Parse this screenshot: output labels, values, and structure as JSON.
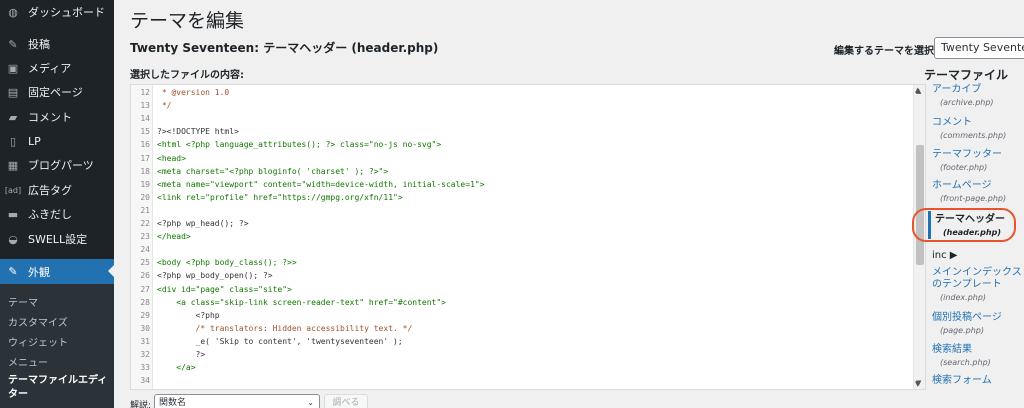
{
  "sidebar": {
    "items": [
      {
        "label": "ダッシュボード",
        "icon": "dashboard-icon",
        "glyph": "◍"
      },
      {
        "label": "投稿",
        "icon": "pin-icon",
        "glyph": "✎"
      },
      {
        "label": "メディア",
        "icon": "media-icon",
        "glyph": "▣"
      },
      {
        "label": "固定ページ",
        "icon": "page-icon",
        "glyph": "▤"
      },
      {
        "label": "コメント",
        "icon": "comment-icon",
        "glyph": "▰"
      },
      {
        "label": "LP",
        "icon": "document-icon",
        "glyph": "▯"
      },
      {
        "label": "ブログパーツ",
        "icon": "blog-parts-icon",
        "glyph": "▦"
      },
      {
        "label": "広告タグ",
        "icon": "ad-tag-icon",
        "glyph": "[ad]"
      },
      {
        "label": "ふきだし",
        "icon": "speech-bubble-icon",
        "glyph": "▬"
      },
      {
        "label": "SWELL設定",
        "icon": "swell-icon",
        "glyph": "◒"
      },
      {
        "label": "外観",
        "icon": "appearance-icon",
        "glyph": "✎"
      }
    ],
    "submenu": [
      {
        "label": "テーマ"
      },
      {
        "label": "カスタマイズ"
      },
      {
        "label": "ウィジェット"
      },
      {
        "label": "メニュー"
      },
      {
        "label": "テーマファイルエディ\nター"
      }
    ]
  },
  "header": {
    "title": "テーマを編集",
    "file_heading": "Twenty Seventeen: テーマヘッダー (header.php)",
    "select_label": "編集するテーマを選択:",
    "selected_theme": "Twenty Seventeen",
    "content_label": "選択したファイルの内容:"
  },
  "editor": {
    "lines": [
      {
        "n": "12",
        "t": " * @version 1.0"
      },
      {
        "n": "13",
        "t": " */"
      },
      {
        "n": "14",
        "t": ""
      },
      {
        "n": "15",
        "t": "?><!DOCTYPE html>"
      },
      {
        "n": "16",
        "t": "<html <?php language_attributes(); ?> class=\"no-js no-svg\">"
      },
      {
        "n": "17",
        "t": "<head>"
      },
      {
        "n": "18",
        "t": "<meta charset=\"<?php bloginfo( 'charset' ); ?>\">"
      },
      {
        "n": "19",
        "t": "<meta name=\"viewport\" content=\"width=device-width, initial-scale=1\">"
      },
      {
        "n": "20",
        "t": "<link rel=\"profile\" href=\"https://gmpg.org/xfn/11\">"
      },
      {
        "n": "21",
        "t": ""
      },
      {
        "n": "22",
        "t": "<?php wp_head(); ?>"
      },
      {
        "n": "23",
        "t": "</head>"
      },
      {
        "n": "24",
        "t": ""
      },
      {
        "n": "25",
        "t": "<body <?php body_class(); ?>>"
      },
      {
        "n": "26",
        "t": "<?php wp_body_open(); ?>"
      },
      {
        "n": "27",
        "t": "<div id=\"page\" class=\"site\">"
      },
      {
        "n": "28",
        "t": "    <a class=\"skip-link screen-reader-text\" href=\"#content\">"
      },
      {
        "n": "29",
        "t": "        <?php"
      },
      {
        "n": "30",
        "t": "        /* translators: Hidden accessibility text. */"
      },
      {
        "n": "31",
        "t": "        _e( 'Skip to content', 'twentyseventeen' );"
      },
      {
        "n": "32",
        "t": "        ?>"
      },
      {
        "n": "33",
        "t": "    </a>"
      },
      {
        "n": "34",
        "t": ""
      }
    ]
  },
  "files": {
    "title": "テーマファイル",
    "entries": [
      {
        "name": "アーカイブ",
        "file": "(archive.php)"
      },
      {
        "name": "コメント",
        "file": "(comments.php)"
      },
      {
        "name": "テーマフッター",
        "file": "(footer.php)"
      },
      {
        "name": "ホームページ",
        "file": "(front-page.php)"
      },
      {
        "name": "テーマヘッダー",
        "file": "(header.php)"
      },
      {
        "name": "メインインデックスのテンプレート",
        "file": "(index.php)"
      },
      {
        "name": "個別投稿ページ",
        "file": "(page.php)"
      },
      {
        "name": "検索結果",
        "file": "(search.php)"
      },
      {
        "name": "検索フォーム",
        "file": ""
      }
    ],
    "dir_label": "inc ▶"
  },
  "bottom": {
    "doc_label": "解説:",
    "func_placeholder": "関数名",
    "lookup_label": "調べる"
  }
}
